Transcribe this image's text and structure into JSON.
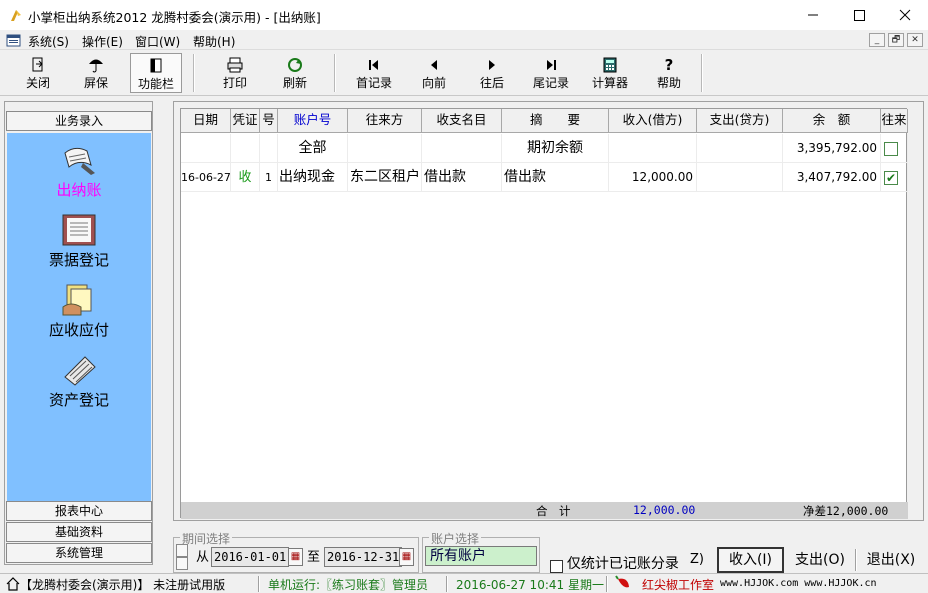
{
  "window": {
    "title": "小掌柜出纳系统2012  龙腾村委会(演示用) - [出纳账]",
    "minimize": "—",
    "maximize": "☐",
    "close": "✕"
  },
  "menu": {
    "items": [
      "系统(S)",
      "操作(E)",
      "窗口(W)",
      "帮助(H)"
    ],
    "mdi_buttons": [
      "_",
      "🗗",
      "✕"
    ]
  },
  "toolbar": {
    "buttons": [
      {
        "label": "关闭",
        "icon": "close-door-icon"
      },
      {
        "label": "屏保",
        "icon": "umbrella-icon"
      },
      {
        "label": "功能栏",
        "icon": "panel-icon"
      },
      {
        "label": "打印",
        "icon": "printer-icon"
      },
      {
        "label": "刷新",
        "icon": "refresh-icon"
      },
      {
        "label": "首记录",
        "icon": "first-record-icon"
      },
      {
        "label": "向前",
        "icon": "previous-icon"
      },
      {
        "label": "往后",
        "icon": "next-icon"
      },
      {
        "label": "尾记录",
        "icon": "last-record-icon"
      },
      {
        "label": "计算器",
        "icon": "calculator-icon"
      },
      {
        "label": "帮助",
        "icon": "help-icon"
      }
    ]
  },
  "sidebar": {
    "top_header": "业务录入",
    "items": [
      {
        "label": "出纳账",
        "active": true
      },
      {
        "label": "票据登记",
        "active": false
      },
      {
        "label": "应收应付",
        "active": false
      },
      {
        "label": "资产登记",
        "active": false
      }
    ],
    "bottom_headers": [
      "报表中心",
      "基础资料",
      "系统管理"
    ]
  },
  "grid": {
    "columns": [
      "日期",
      "凭证",
      "号",
      "账户号",
      "往来方",
      "收支名目",
      "摘　　要",
      "收入(借方)",
      "支出(贷方)",
      "余　额",
      "往来"
    ],
    "rows": [
      {
        "date": "",
        "voucher": "",
        "no": "",
        "account": "全部",
        "party": "",
        "category": "",
        "summary": "期初余额",
        "income": "",
        "expense": "",
        "balance": "3,395,792.00",
        "checked": false
      },
      {
        "date": "16-06-27",
        "voucher": "收",
        "no": "1",
        "account": "出纳现金",
        "party": "东二区租户",
        "category": "借出款",
        "summary": "借出款",
        "income": "12,000.00",
        "expense": "",
        "balance": "3,407,792.00",
        "checked": true
      }
    ],
    "footer": {
      "label": "合　计",
      "income_total": "12,000.00",
      "net": "净差12,000.00"
    }
  },
  "period": {
    "title": "期间选择",
    "from_label": "从",
    "from": "2016-01-01",
    "to_label": "至",
    "to": "2016-12-31"
  },
  "account_select": {
    "title": "账户选择",
    "value": "所有账户"
  },
  "bottom": {
    "checkbox_label": "仅统计已记账分录",
    "z_label": "Z)",
    "income_button": "收入(I)",
    "expense_button": "支出(O)",
    "exit_button": "退出(X)"
  },
  "status": {
    "org": "【龙腾村委会(演示用)】 未注册试用版",
    "mode": "单机运行:〖练习账套〗管理员",
    "datetime": "2016-06-27 10:41 星期一",
    "studio": "红尖椒工作室",
    "urls": "www.HJJOK.com www.HJJOK.cn"
  }
}
